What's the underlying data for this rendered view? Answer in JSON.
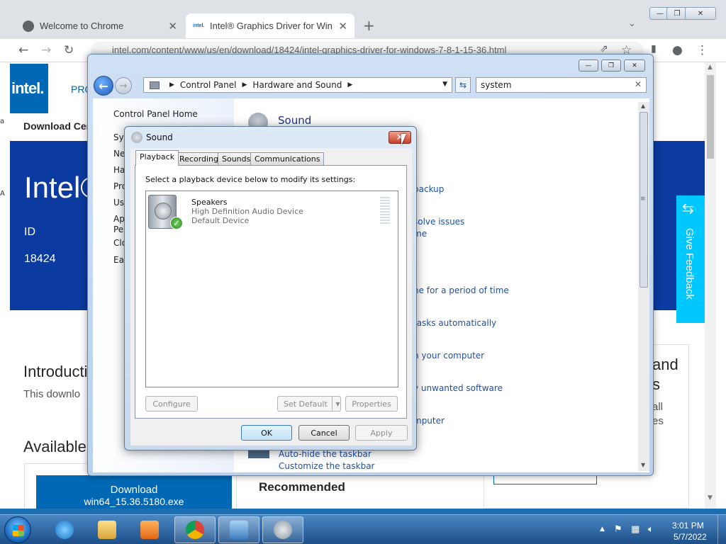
{
  "browser": {
    "tabs": [
      {
        "title": "Welcome to Chrome",
        "close": "✕",
        "active": false
      },
      {
        "title": "Intel® Graphics Driver for Windo",
        "close": "✕",
        "active": true
      }
    ],
    "new_tab": "+",
    "tab_search": "⌄",
    "url": "intel.com/content/www/us/en/download/18424/intel-graphics-driver-for-windows-7-8-1-15-36.html",
    "window_controls": [
      "—",
      "❐",
      "✕"
    ],
    "icons": {
      "back": "←",
      "forward": "→",
      "reload": "↻",
      "share": "⇗",
      "star": "☆",
      "sidebar": "▮",
      "profile": "●",
      "menu": "⋮",
      "lock": "🔒"
    }
  },
  "page": {
    "logo": "intel.",
    "nav_item": "PRO",
    "download_center": "Download Cer",
    "hero_title": "Intel®",
    "id_label": "ID",
    "id_value": "18424",
    "intro_heading": "Introducti",
    "intro_text": "This downlo",
    "available_heading": "Available",
    "download_label": "Download",
    "download_file": "win64_15.36.5180.exe",
    "recommended": "Recommended",
    "side_and": "and",
    "side_s": "s",
    "side_all": "all",
    "side_es": "es",
    "feedback_label": "Give Feedback",
    "edge_a": "a",
    "edge_b": "A"
  },
  "control_panel": {
    "breadcrumb": [
      "Control Panel",
      "Hardware and Sound"
    ],
    "search_value": "system",
    "left_home": "Control Panel Home",
    "left_items": [
      "Sys",
      "Ne",
      "Ha",
      "Pro",
      "Use",
      "Ap",
      "Per",
      "Clo",
      "Eas"
    ],
    "section_title": "Sound",
    "links": [
      "backup",
      "solve issues",
      "me",
      "ne for a period of time",
      "tasks automatically",
      "n your computer",
      "y unwanted software",
      "mputer",
      "Auto-hide the taskbar",
      "Customize the taskbar"
    ]
  },
  "sound_dialog": {
    "title": "Sound",
    "tabs": [
      "Playback",
      "Recording",
      "Sounds",
      "Communications"
    ],
    "active_tab": "Playback",
    "prompt": "Select a playback device below to modify its settings:",
    "device": {
      "name": "Speakers",
      "description": "High Definition Audio Device",
      "status": "Default Device"
    },
    "buttons": {
      "configure": "Configure",
      "set_default": "Set Default",
      "properties": "Properties",
      "ok": "OK",
      "cancel": "Cancel",
      "apply": "Apply"
    }
  },
  "taskbar": {
    "apps": [
      "Internet Explorer",
      "Windows Explorer",
      "Media Player",
      "Google Chrome",
      "Control Panel",
      "Sound"
    ],
    "time": "3:01 PM",
    "date": "5/7/2022"
  }
}
